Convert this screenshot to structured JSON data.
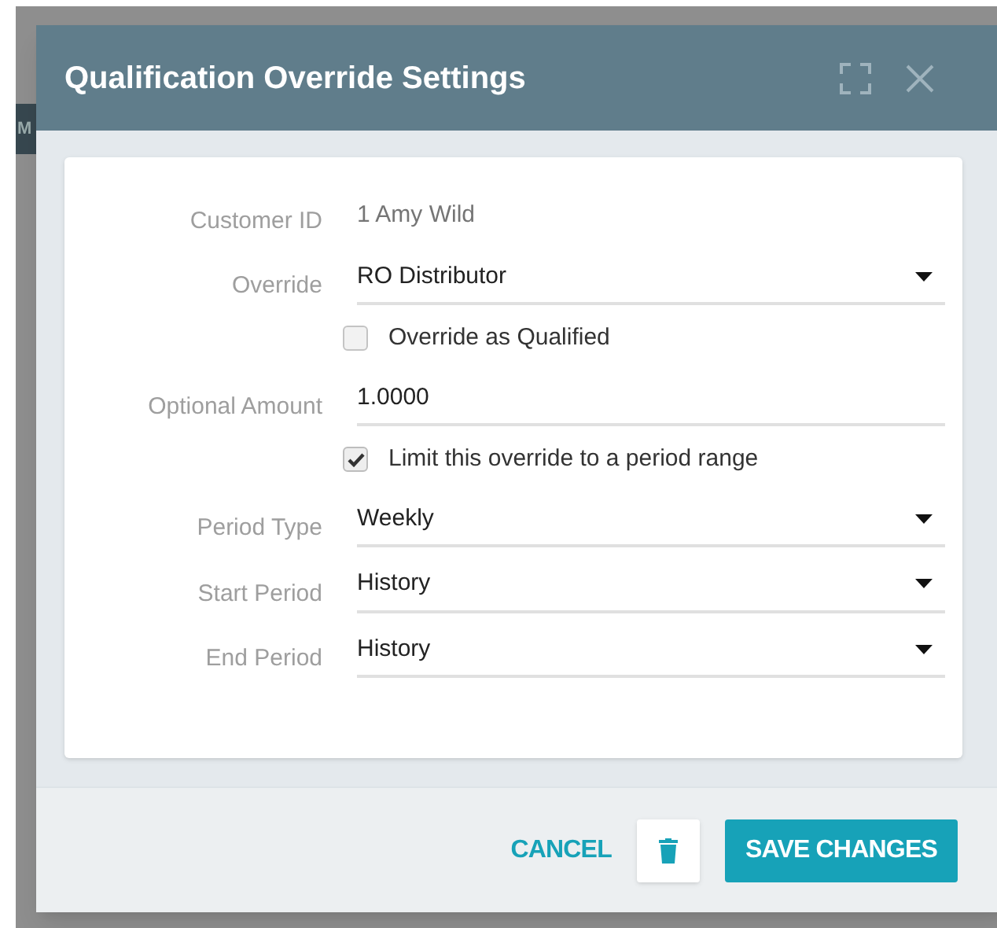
{
  "background": {
    "tab_label": "M"
  },
  "dialog": {
    "title": "Qualification Override Settings"
  },
  "rows": [
    {
      "kind": "text",
      "label": "Customer ID",
      "value": "1 Amy Wild"
    },
    {
      "kind": "select",
      "label": "Override",
      "value": "RO Distributor"
    },
    {
      "kind": "checkbox",
      "label": "Override as Qualified",
      "checked": false
    },
    {
      "kind": "input",
      "label": "Optional Amount",
      "value": "1.0000"
    },
    {
      "kind": "checkbox",
      "label": "Limit this override to a period range",
      "checked": true
    },
    {
      "kind": "select",
      "label": "Period Type",
      "value": "Weekly"
    },
    {
      "kind": "select",
      "label": "Start Period",
      "value": "History"
    },
    {
      "kind": "select",
      "label": "End Period",
      "value": "History"
    }
  ],
  "footer": {
    "cancel": "CANCEL",
    "save": "SAVE CHANGES"
  }
}
